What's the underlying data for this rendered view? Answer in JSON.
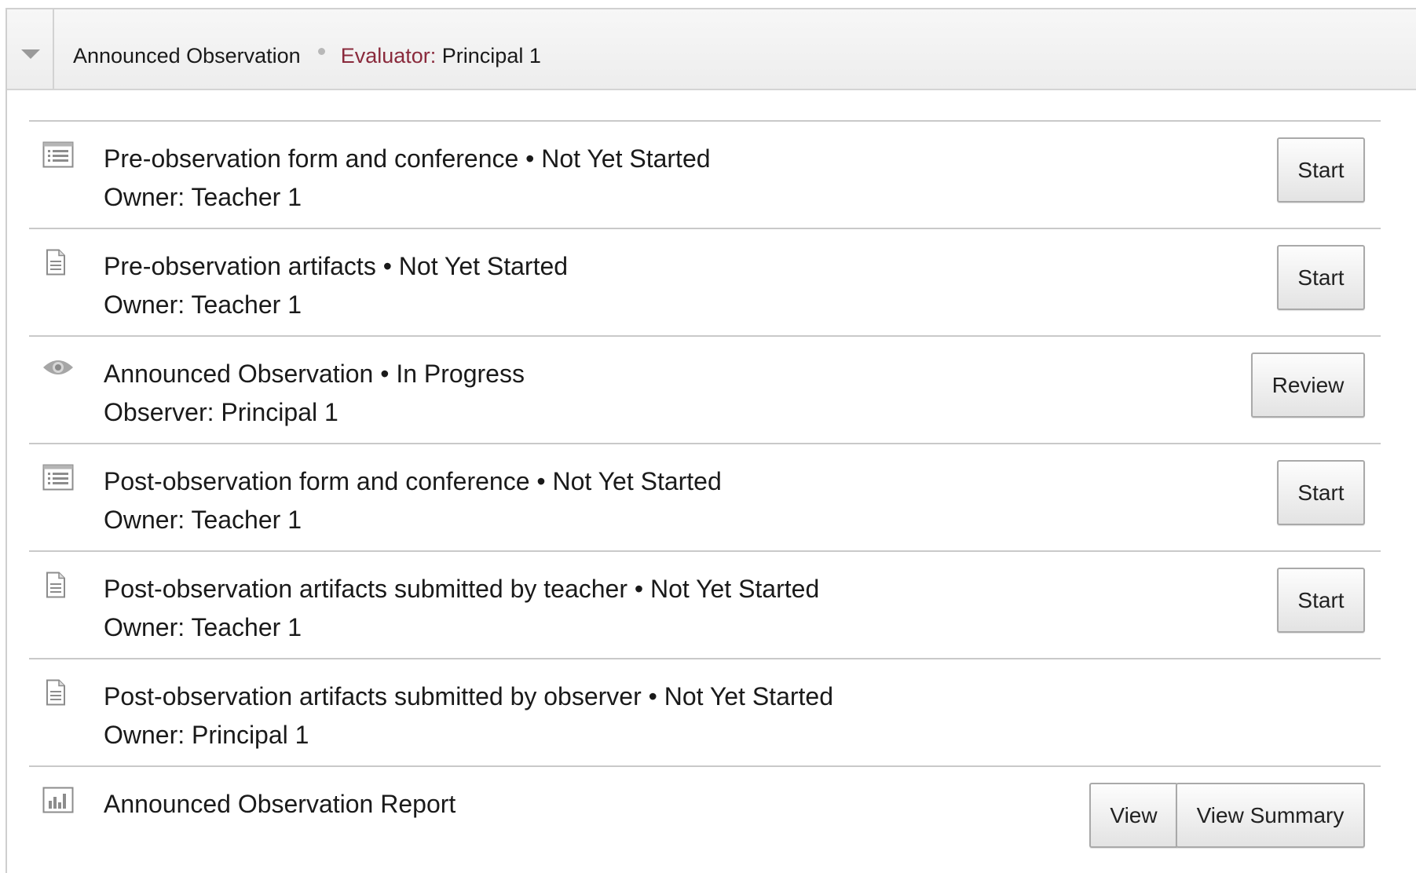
{
  "header": {
    "title": "Announced Observation",
    "evaluator_label": "Evaluator:",
    "evaluator_name": "Principal 1"
  },
  "items": [
    {
      "icon": "list-form-icon",
      "title": "Pre-observation form and conference",
      "status": "Not Yet Started",
      "sub": "Owner: Teacher 1",
      "button": "Start"
    },
    {
      "icon": "document-icon",
      "title": "Pre-observation artifacts",
      "status": "Not Yet Started",
      "sub": "Owner: Teacher 1",
      "button": "Start"
    },
    {
      "icon": "eye-icon",
      "title": "Announced Observation",
      "status": "In Progress",
      "sub": "Observer: Principal 1",
      "button": "Review"
    },
    {
      "icon": "list-form-icon",
      "title": "Post-observation form and conference",
      "status": "Not Yet Started",
      "sub": "Owner: Teacher 1",
      "button": "Start"
    },
    {
      "icon": "document-icon",
      "title": "Post-observation artifacts submitted by teacher",
      "status": "Not Yet Started",
      "sub": "Owner: Teacher 1",
      "button": "Start"
    },
    {
      "icon": "document-icon",
      "title": "Post-observation artifacts submitted by observer",
      "status": "Not Yet Started",
      "sub": "Owner: Principal 1"
    },
    {
      "icon": "bar-chart-icon",
      "title": "Announced Observation Report",
      "buttons": [
        "View",
        "View Summary"
      ]
    }
  ],
  "separator": "•",
  "colors": {
    "evaluator_label": "#8a2a3c",
    "row_border": "#c9c9c9",
    "icon": "#8c8c8c"
  }
}
